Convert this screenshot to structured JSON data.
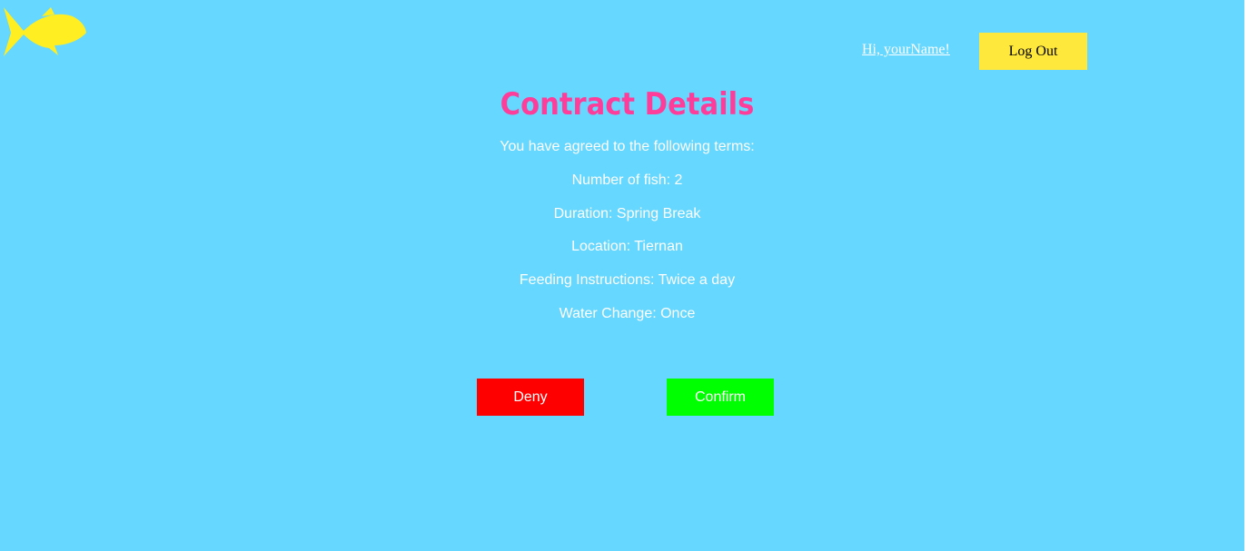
{
  "header": {
    "logo_icon": "fish-icon",
    "logo_color": "#ffee22",
    "greeting": "Hi, yourName!",
    "logout_label": "Log Out"
  },
  "contract": {
    "title": "Contract Details",
    "intro": "You have agreed to the following terms:",
    "terms": [
      "Number of fish: 2",
      "Duration: Spring Break",
      "Location: Tiernan",
      "Feeding Instructions: Twice a day",
      "Water Change: Once"
    ]
  },
  "actions": {
    "deny_label": "Deny",
    "confirm_label": "Confirm"
  },
  "colors": {
    "background": "#66d7fe",
    "title": "#fd3d99",
    "logout_button": "#ffe83c",
    "deny_button": "#ff0000",
    "confirm_button": "#00ff00"
  }
}
